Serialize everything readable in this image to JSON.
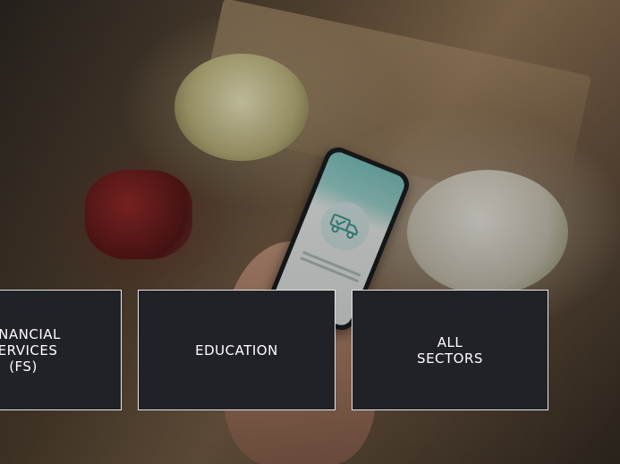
{
  "sectors": {
    "tiles": [
      {
        "label": "FINANCIAL\nSERVICES\n(FS)"
      },
      {
        "label": "EDUCATION"
      },
      {
        "label": "ALL\nSECTORS"
      }
    ]
  },
  "colors": {
    "tile_background": "#212128",
    "tile_border": "#e6e6e6",
    "tile_text": "#ffffff",
    "phone_accent": "#7cc4bf"
  },
  "icons": {
    "phone_screen_icon": "delivery-truck-icon"
  }
}
